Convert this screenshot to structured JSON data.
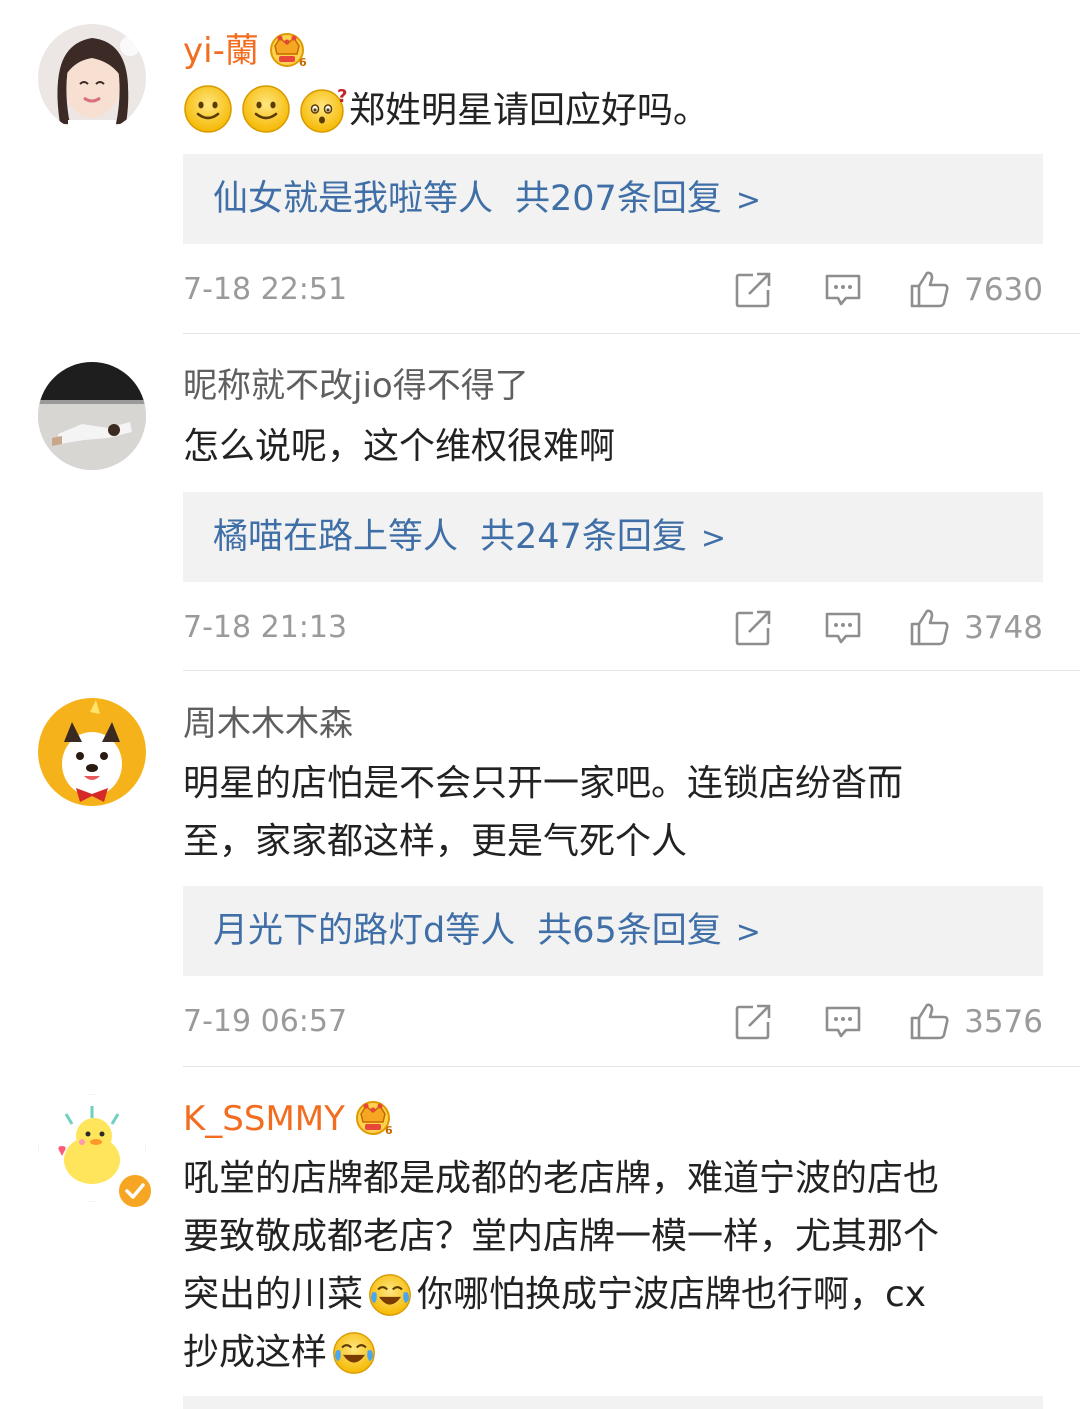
{
  "comments": [
    {
      "user": "yi-蘭",
      "text": "郑姓明星请回应好吗。",
      "replies_users": "仙女就是我啦等人",
      "replies_count": "共207条回复",
      "arrow": ">",
      "time": "7-18 22:51",
      "likes": "7630"
    },
    {
      "user": "昵称就不改jio得不得了",
      "text": "怎么说呢，这个维权很难啊",
      "replies_users": "橘喵在路上等人",
      "replies_count": "共247条回复",
      "arrow": ">",
      "time": "7-18 21:13",
      "likes": "3748"
    },
    {
      "user": "周木木木森",
      "text_line1": "明星的店怕是不会只开一家吧。连锁店纷沓而",
      "text_line2": "至，家家都这样，更是气死个人",
      "replies_users": "月光下的路灯d等人",
      "replies_count": "共65条回复",
      "arrow": ">",
      "time": "7-19 06:57",
      "likes": "3576"
    },
    {
      "user": "K_SSMMY",
      "text_line1": "吼堂的店牌都是成都的老店牌，难道宁波的店也",
      "text_line2": "要致敬成都老店？堂内店牌一模一样，尤其那个",
      "text_line3a": "突出的川菜",
      "text_line3b": "你哪怕换成宁波店牌也行啊，cx",
      "text_line4": "抄成这样"
    }
  ],
  "icons": {
    "crown": "vip-crown-icon",
    "share": "share-icon",
    "comment": "comment-icon",
    "like": "thumbs-up-icon",
    "smile": "smile-emoji",
    "doubt": "doubt-emoji",
    "laugh_cry": "laugh-cry-emoji"
  },
  "colors": {
    "vip_name": "#f26d1f",
    "reply_link": "#3f6fa6",
    "meta_gray": "#9a9a9a",
    "reply_bg": "#f2f2f2"
  }
}
